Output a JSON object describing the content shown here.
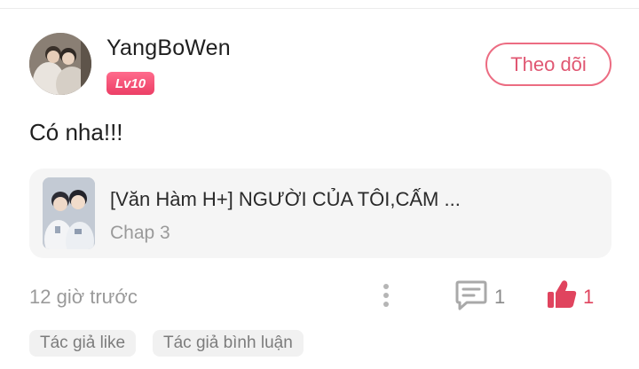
{
  "user": {
    "name": "YangBoWen",
    "level": "Lv10"
  },
  "follow_button": {
    "label": "Theo dõi"
  },
  "comment": {
    "text": "Có nha!!!"
  },
  "chapter_card": {
    "title": "[Văn Hàm H+] NGƯỜI CỦA TÔI,CẤM ...",
    "subtitle": "Chap 3"
  },
  "footer": {
    "timestamp": "12 giờ trước",
    "comment_count": "1",
    "like_count": "1"
  },
  "tags": [
    {
      "label": "Tác giả like"
    },
    {
      "label": "Tác giả bình luận"
    }
  ],
  "colors": {
    "accent": "#e05772",
    "badge": "#ec3f66",
    "like": "#e0445e",
    "muted": "#9a9a9a"
  },
  "icons": {
    "more": "more-vertical-icon",
    "comment": "comment-icon",
    "like": "thumbs-up-icon"
  }
}
